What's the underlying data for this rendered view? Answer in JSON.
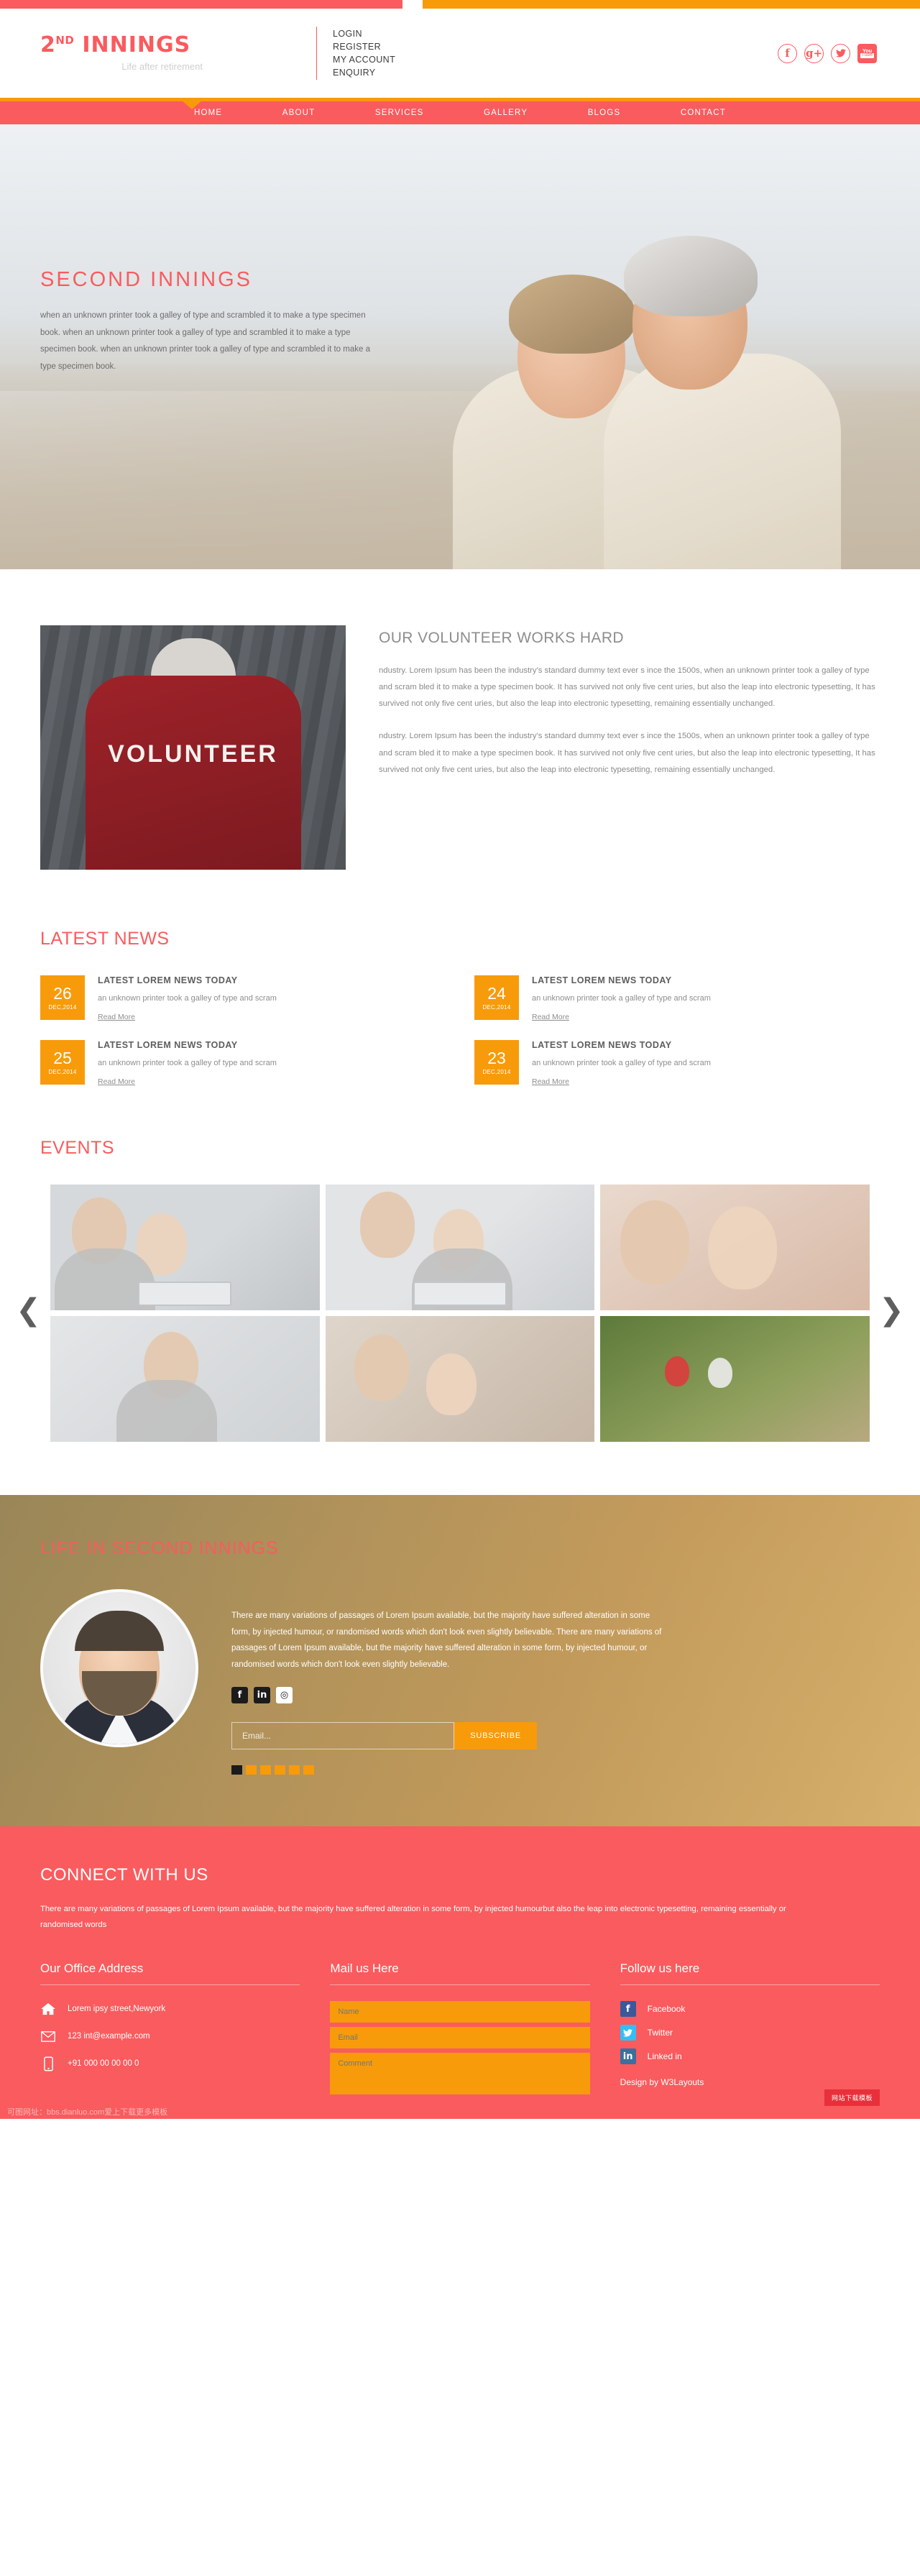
{
  "topbar": {
    "account_links": [
      "LOGIN",
      "REGISTER",
      "MY ACCOUNT",
      "ENQUIRY"
    ],
    "social": [
      {
        "name": "facebook-icon",
        "glyph": "f"
      },
      {
        "name": "googleplus-icon",
        "glyph": "g+"
      },
      {
        "name": "twitter-icon",
        "glyph": "ᵕ"
      },
      {
        "name": "youtube-icon",
        "top": "You",
        "bottom": "Tube"
      }
    ],
    "colors": {
      "red": "#fa5b5e",
      "orange": "#f79b0b"
    }
  },
  "logo": {
    "number": "2",
    "sup": "ND",
    "word": "INNINGS",
    "tagline": "Life after retirement"
  },
  "nav": {
    "items": [
      "HOME",
      "ABOUT",
      "SERVICES",
      "GALLERY",
      "BLOGS",
      "CONTACT"
    ],
    "active": "HOME"
  },
  "hero": {
    "title": "SECOND  INNINGS",
    "description": "when an unknown printer took a galley of type and scrambled it to make a type specimen book. when an unknown printer took a galley of type and scrambled it to make a type specimen book. when an unknown printer took a galley of type and scrambled it to make a type specimen book."
  },
  "volunteer": {
    "image_label": "VOLUNTEER",
    "heading": "OUR VOLUNTEER WORKS HARD",
    "paragraph1": "ndustry. Lorem Ipsum has been the industry's standard dummy text ever s ince the 1500s, when an unknown printer took a galley of type and scram bled it to make a type specimen book. It has survived not only five cent uries, but also the leap into electronic typesetting, It has survived not only five cent uries, but also the leap into electronic typesetting, remaining essentially unchanged.",
    "paragraph2": "ndustry. Lorem Ipsum has been the industry's standard dummy text ever s ince the 1500s, when an unknown printer took a galley of type and scram bled it to make a type specimen book. It has survived not only five cent uries, but also the leap into electronic typesetting, It has survived not only five cent uries, but also the leap into electronic typesetting, remaining essentially unchanged."
  },
  "news": {
    "title": "LATEST NEWS",
    "items": [
      {
        "day": "26",
        "month": "DEC,2014",
        "title": "LATEST LOREM NEWS TODAY",
        "excerpt": "an unknown printer took a galley of type and scram",
        "link": "Read More"
      },
      {
        "day": "24",
        "month": "DEC,2014",
        "title": "LATEST LOREM NEWS TODAY",
        "excerpt": "an unknown printer took a galley of type and scram",
        "link": "Read More"
      },
      {
        "day": "25",
        "month": "DEC,2014",
        "title": "LATEST LOREM NEWS TODAY",
        "excerpt": "an unknown printer took a galley of type and scram",
        "link": "Read More"
      },
      {
        "day": "23",
        "month": "DEC,2014",
        "title": "LATEST LOREM NEWS TODAY",
        "excerpt": "an unknown printer took a galley of type and scram",
        "link": "Read More"
      }
    ]
  },
  "events": {
    "title": "EVENTS",
    "prev": "❮",
    "next": "❯",
    "count": 6
  },
  "life": {
    "title": "LIFE IN SECOND INNINGS",
    "paragraph": "There are many variations of passages of Lorem Ipsum available, but the majority have suffered alteration in some form, by injected humour, or randomised words which don't look even slightly believable. There are many variations of passages of Lorem Ipsum available, but the majority have suffered alteration in some form, by injected humour, or randomised words which don't look even slightly believable.",
    "social": [
      {
        "name": "facebook-icon",
        "glyph": "f"
      },
      {
        "name": "linkedin-icon",
        "glyph": "in"
      },
      {
        "name": "instagram-icon",
        "glyph": "◎"
      }
    ],
    "email_placeholder": "Email...",
    "subscribe_label": "SUBSCRIBE",
    "dots": [
      true,
      false,
      false,
      false,
      false,
      false
    ]
  },
  "footer": {
    "title": "CONNECT WITH US",
    "intro": "There are many variations of passages of Lorem Ipsum available, but the majority have suffered alteration in some form, by injected humourbut also the leap into electronic typesetting, remaining essentially or randomised words",
    "office": {
      "heading": "Our Office Address",
      "address": "Lorem ipsy street,Newyork",
      "email": "123 int@example.com",
      "phone": "+91 000 00 00 00 0"
    },
    "mail": {
      "heading": "Mail us Here",
      "name_placeholder": "Name",
      "email_placeholder": "Email",
      "comment_placeholder": "Comment"
    },
    "follow": {
      "heading": "Follow us here",
      "links": [
        {
          "name": "facebook-icon",
          "glyph": "f",
          "label": "Facebook"
        },
        {
          "name": "twitter-icon",
          "glyph": "ᵕ",
          "label": "Twitter"
        },
        {
          "name": "linkedin-icon",
          "glyph": "in",
          "label": "Linked in"
        }
      ],
      "design_by": "Design by  W3Layouts"
    },
    "badge": "网站下载模板",
    "watermark": "可图网址：bbs.dianluo.com爱上下载更多模板"
  }
}
